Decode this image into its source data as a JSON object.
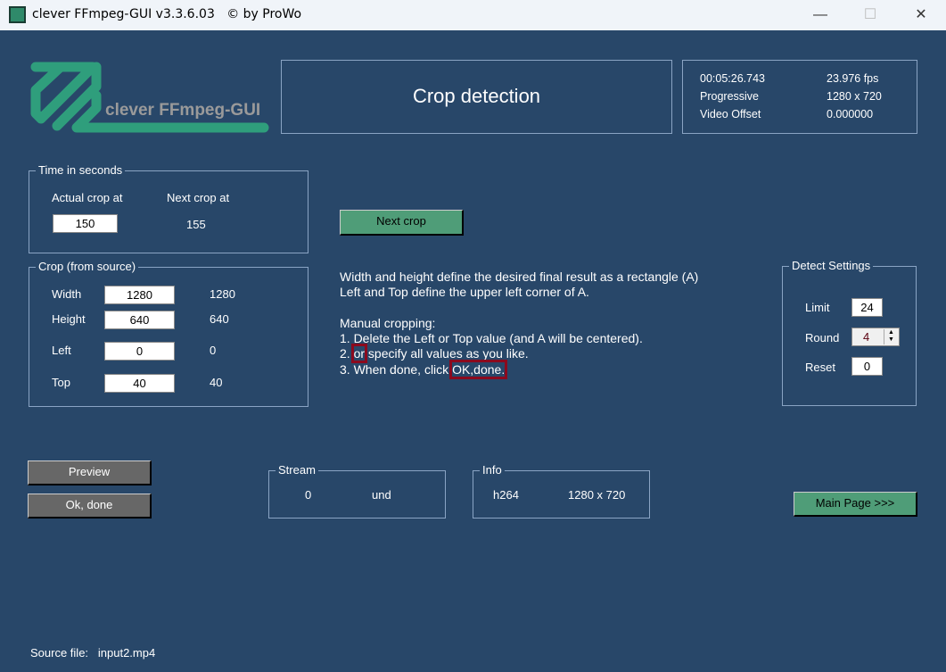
{
  "window": {
    "title": "clever FFmpeg-GUI v3.3.6.03   © by ProWo",
    "minimize": "—",
    "maximize": "☐",
    "close": "✕"
  },
  "logo": {
    "text": "clever FFmpeg-GUI"
  },
  "header": {
    "title": "Crop detection"
  },
  "info": {
    "duration": "00:05:26.743",
    "fps": "23.976 fps",
    "scan": "Progressive",
    "resolution": "1280 x 720",
    "offset_label": "Video Offset",
    "offset": "0.000000"
  },
  "time": {
    "legend": "Time in seconds",
    "actual_label": "Actual crop at",
    "next_label": "Next crop at",
    "actual": "150",
    "next": "155"
  },
  "next_crop": "Next crop",
  "crop": {
    "legend": "Crop (from source)",
    "rows": [
      {
        "label": "Width",
        "value": "1280",
        "source": "1280"
      },
      {
        "label": "Height",
        "value": "640",
        "source": "640"
      },
      {
        "label": "Left",
        "value": "0",
        "source": "0"
      },
      {
        "label": "Top",
        "value": "40",
        "source": "40"
      }
    ]
  },
  "instructions": {
    "l1": "Width and height define the desired final result as a rectangle (A)",
    "l2": "Left and Top define the upper left corner of A.",
    "l3": "Manual cropping:",
    "l4": "1. Delete the Left or Top value (and A will be centered).",
    "l5a": "2. ",
    "l5b": "or",
    "l5c": " specify all values as you like.",
    "l6a": "3. When done, click ",
    "l6b": "OK,done."
  },
  "detect": {
    "legend": "Detect Settings",
    "limit_label": "Limit",
    "limit": "24",
    "round_label": "Round",
    "round": "4",
    "reset_label": "Reset",
    "reset": "0"
  },
  "buttons": {
    "preview": "Preview",
    "ok": "Ok, done",
    "main": "Main Page >>>"
  },
  "stream": {
    "legend": "Stream",
    "index": "0",
    "lang": "und"
  },
  "infobox": {
    "legend": "Info",
    "codec": "h264",
    "res": "1280 x 720"
  },
  "source": {
    "label": "Source file:",
    "file": "input2.mp4"
  }
}
